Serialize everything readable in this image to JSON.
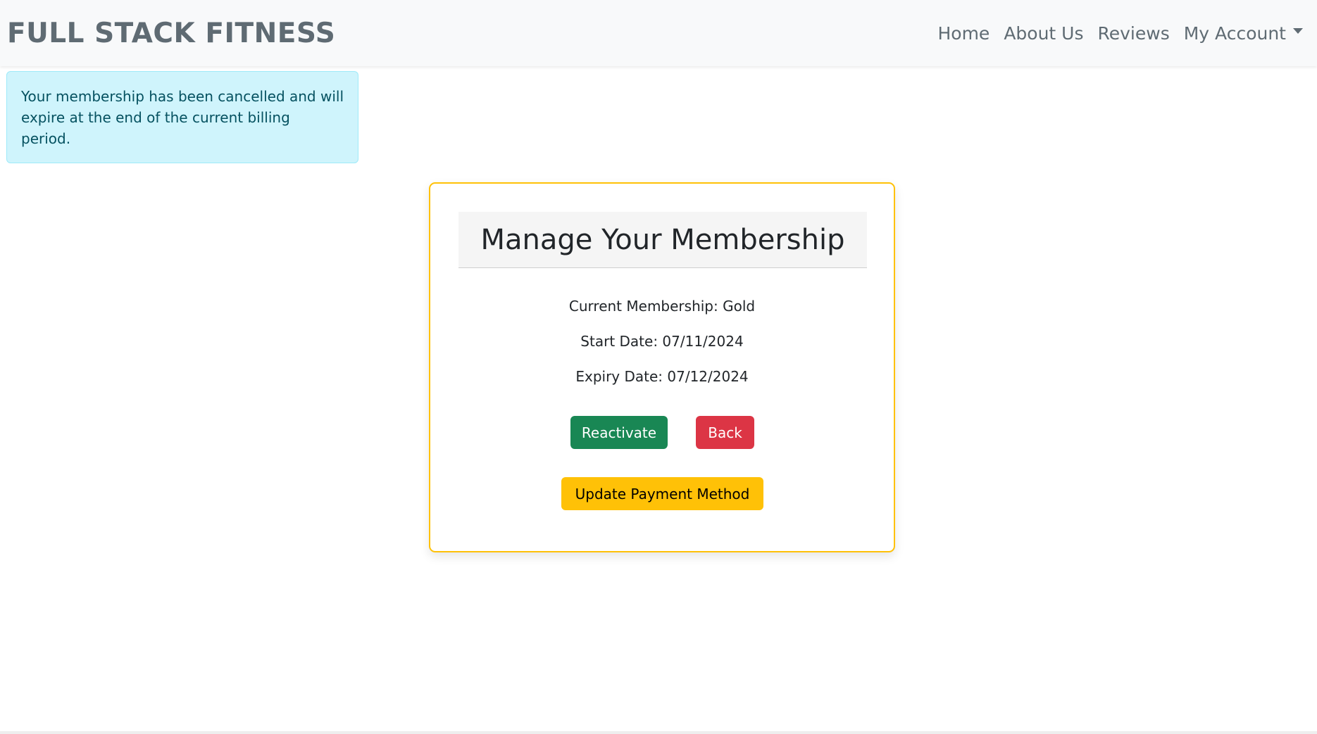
{
  "navbar": {
    "brand": "FULL STACK FITNESS",
    "links": {
      "home": "Home",
      "about": "About Us",
      "reviews": "Reviews",
      "account": "My Account"
    }
  },
  "alert": {
    "message": "Your membership has been cancelled and will expire at the end of the current billing period."
  },
  "card": {
    "title": "Manage Your Membership",
    "current_membership": "Current Membership: Gold",
    "start_date": "Start Date: 07/11/2024",
    "expiry_date": "Expiry Date: 07/12/2024",
    "buttons": {
      "reactivate": "Reactivate",
      "back": "Back",
      "update_payment": "Update Payment Method"
    }
  },
  "colors": {
    "navbar_bg": "#f8f9fa",
    "alert_bg": "#cff4fc",
    "card_border": "#ffc107",
    "success": "#198754",
    "danger": "#dc3545",
    "warning": "#ffc107"
  }
}
